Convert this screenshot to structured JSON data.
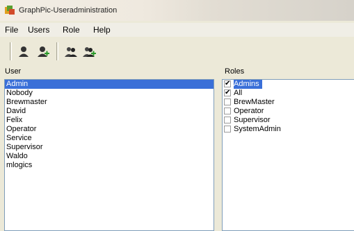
{
  "window": {
    "title": "GraphPic-Useradministration",
    "icon": "graphpic-app-icon"
  },
  "menu": {
    "items": [
      {
        "label": "File"
      },
      {
        "label": "Users"
      },
      {
        "label": "Role"
      },
      {
        "label": "Help"
      }
    ]
  },
  "toolbar": {
    "buttons": [
      {
        "icon": "user-icon"
      },
      {
        "icon": "add-user-icon"
      },
      {
        "icon": "role-icon"
      },
      {
        "icon": "add-role-icon"
      }
    ]
  },
  "user_panel": {
    "label": "User",
    "items": [
      {
        "label": "Admin",
        "selected": true
      },
      {
        "label": "Nobody"
      },
      {
        "label": "Brewmaster"
      },
      {
        "label": "David"
      },
      {
        "label": "Felix"
      },
      {
        "label": "Operator"
      },
      {
        "label": "Service"
      },
      {
        "label": "Supervisor"
      },
      {
        "label": "Waldo"
      },
      {
        "label": "mlogics"
      }
    ]
  },
  "roles_panel": {
    "label": "Roles",
    "items": [
      {
        "label": "Admins",
        "checked": true,
        "selected": true
      },
      {
        "label": "All",
        "checked": true
      },
      {
        "label": "BrewMaster",
        "checked": false
      },
      {
        "label": "Operator",
        "checked": false
      },
      {
        "label": "Supervisor",
        "checked": false
      },
      {
        "label": "SystemAdmin",
        "checked": false
      }
    ]
  },
  "colors": {
    "selection": "#3a6fd8",
    "window_bg": "#ece9d8",
    "list_border": "#7f9db9"
  }
}
